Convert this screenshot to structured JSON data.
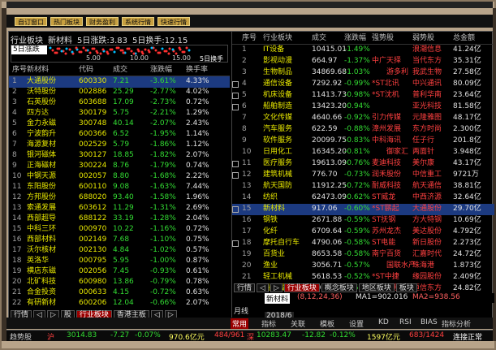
{
  "toolbar": {
    "buttons": [
      "自订窗口",
      "热门板块",
      "财务盈利",
      "系统行情",
      "快速行情"
    ]
  },
  "left": {
    "title_parts": [
      "行业板块",
      "新材料",
      "5日涨跌:3.83",
      "5日换手:12.15"
    ],
    "window_label": "5日涨跌",
    "scale": [
      "5.00",
      "10.00",
      "15.00",
      "5日换手"
    ],
    "headers": [
      "序号",
      "新材料",
      "代码",
      "成交",
      "涨跌幅",
      "换手率"
    ],
    "rows": [
      [
        "1",
        "大通股份",
        "600330",
        "7.21",
        "-3.61%",
        "4.33%"
      ],
      [
        "2",
        "沃特股份",
        "002886",
        "25.29",
        "-2.77%",
        "4.02%"
      ],
      [
        "3",
        "石英股份",
        "603688",
        "17.09",
        "-2.73%",
        "0.72%"
      ],
      [
        "4",
        "四方达",
        "300179",
        "5.75",
        "-2.21%",
        "1.29%"
      ],
      [
        "5",
        "金力永磁",
        "300748",
        "40.14",
        "-2.07%",
        "2.43%"
      ],
      [
        "6",
        "宁波韵升",
        "600366",
        "6.52",
        "-1.95%",
        "1.14%"
      ],
      [
        "7",
        "海源复材",
        "002529",
        "5.79",
        "-1.86%",
        "1.12%"
      ],
      [
        "8",
        "银河磁体",
        "300127",
        "18.85",
        "-1.82%",
        "2.07%"
      ],
      [
        "9",
        "正海磁材",
        "300224",
        "8.76",
        "-1.79%",
        "0.74%"
      ],
      [
        "10",
        "中钢天源",
        "002057",
        "8.80",
        "-1.68%",
        "2.22%"
      ],
      [
        "11",
        "东阳股份",
        "600110",
        "9.08",
        "-1.63%",
        "7.44%"
      ],
      [
        "12",
        "方邦股份",
        "688020",
        "93.40",
        "-1.58%",
        "1.96%"
      ],
      [
        "13",
        "索通发展",
        "603612",
        "11.29",
        "-1.31%",
        "2.69%"
      ],
      [
        "14",
        "西部超导",
        "688122",
        "33.19",
        "-1.28%",
        "2.04%"
      ],
      [
        "15",
        "中科三环",
        "000970",
        "10.22",
        "-1.16%",
        "0.72%"
      ],
      [
        "16",
        "西部材料",
        "002149",
        "7.68",
        "-1.10%",
        "0.75%"
      ],
      [
        "17",
        "沃尔核材",
        "002130",
        "4.84",
        "-1.02%",
        "0.57%"
      ],
      [
        "18",
        "英洛华",
        "000795",
        "5.95",
        "-1.00%",
        "0.87%"
      ],
      [
        "19",
        "横店东磁",
        "002056",
        "7.45",
        "-0.93%",
        "0.61%"
      ],
      [
        "20",
        "北矿科技",
        "600980",
        "13.86",
        "-0.79%",
        "0.78%"
      ],
      [
        "21",
        "合金投资",
        "000633",
        "4.15",
        "-0.72%",
        "0.63%"
      ],
      [
        "22",
        "有研新材",
        "600206",
        "12.04",
        "-0.66%",
        "2.07%"
      ]
    ],
    "tabs": [
      "行情",
      "◁",
      "▷",
      "股",
      "行业板块",
      "香港主板",
      "◁",
      "▷"
    ]
  },
  "right": {
    "headers": [
      "序号",
      "行业板块",
      "成交",
      "涨跌幅",
      "强势股",
      "弱势股",
      "总金额"
    ],
    "rows": [
      [
        "1",
        "IT设备",
        "10415.01",
        "-1.49%",
        "",
        "浪潮信息",
        "41.24亿"
      ],
      [
        "2",
        "影视动漫",
        "664.97",
        "-1.37%",
        "中广天择",
        "当代东方",
        "35.31亿"
      ],
      [
        "3",
        "生物制品",
        "34869.68",
        "-1.03%",
        "",
        "游多利",
        "我武生物",
        "27.58亿"
      ],
      [
        "4",
        "通信设备",
        "7292.92",
        "-0.99%",
        "*ST北讯",
        "中兴通讯",
        "80.09亿"
      ],
      [
        "5",
        "机床设备",
        "11413.73",
        "-0.98%",
        "*ST沈机",
        "普利华南",
        "23.64亿"
      ],
      [
        "6",
        "船舶制造",
        "13423.20",
        "-0.94%",
        "",
        "亚光科技",
        "81.58亿"
      ],
      [
        "7",
        "文化传媒",
        "4640.66",
        "-0.92%",
        "引力传媒",
        "元隆雅图",
        "48.17亿"
      ],
      [
        "8",
        "汽车服务",
        "622.59",
        "-0.88%",
        "漳州发展",
        "东方时尚",
        "2.300亿"
      ],
      [
        "9",
        "软件服务",
        "20099.75",
        "-0.83%",
        "中科海讯",
        "任子行",
        "201.8亿"
      ],
      [
        "10",
        "日用化工",
        "16345.20",
        "-0.81%",
        "",
        "御家汇",
        "两面针",
        "3.948亿"
      ],
      [
        "11",
        "医疗服务",
        "19613.09",
        "-0.76%",
        "麦迪科技",
        "美尔康",
        "43.17亿"
      ],
      [
        "12",
        "建筑机械",
        "776.70",
        "-0.73%",
        "润禾股份",
        "中信重工",
        "9721万"
      ],
      [
        "13",
        "航天国防",
        "11912.25",
        "-0.72%",
        "耐威科技",
        "航天通信",
        "38.81亿"
      ],
      [
        "14",
        "纺织",
        "62473.09",
        "-0.62%",
        "ST威龙",
        "中西济源",
        "32.64亿"
      ],
      [
        "15",
        "新材料",
        "917.06",
        "-0.60%",
        "*ST鹏起",
        "大通股份",
        "29.70亿"
      ],
      [
        "16",
        "钢铁",
        "2671.88",
        "-0.59%",
        "ST抚钢",
        "方大特钢",
        "10.69亿"
      ],
      [
        "17",
        "化纤",
        "6709.64",
        "-0.59%",
        "苏州龙杰",
        "美达股份",
        "4.792亿"
      ],
      [
        "18",
        "摩托自行车",
        "4790.06",
        "-0.58%",
        "ST电能",
        "新日股份",
        "2.273亿"
      ],
      [
        "19",
        "百货业",
        "8653.58",
        "-0.58%",
        "南宁百货",
        "汇嘉时代",
        "24.72亿"
      ],
      [
        "20",
        "渔业",
        "3056.71",
        "-0.57%",
        "",
        "国联水产",
        "珠海港",
        "1.873亿"
      ],
      [
        "21",
        "轻工机械",
        "5618.53",
        "-0.52%",
        "*ST中捷",
        "缘园股份",
        "2.409亿"
      ],
      [
        "22",
        "通信服务",
        "5904.50",
        "-0.50%",
        "号百控股",
        "恒信东方",
        "24.82亿"
      ]
    ],
    "tabs": [
      "行情",
      "◁",
      "▷",
      "行业板块",
      "概念板块",
      "地区板块",
      "板块"
    ],
    "indicator": {
      "name": "新材料",
      "param": "(8,12,24,36)",
      "ma1": "MA1=902.016",
      "ma2": "MA2=938.56"
    },
    "period": "月线",
    "date": "2018/6",
    "bottom_tabs": [
      "常用",
      "指标",
      "关联",
      "模板",
      "设置",
      "KD",
      "RSI",
      "BIAS",
      "指标分析"
    ]
  },
  "status": {
    "sh_label": "沪",
    "sh_index": "3014.83",
    "sh_change": "-7.27",
    "sh_pct": "-0.07%",
    "sh_amount": "970.6亿元",
    "sh_updown": "484/961",
    "sz_label": "深",
    "sz_index": "10283.47",
    "sz_change": "-12.82",
    "sz_pct": "-0.12%",
    "sz_amount": "1597亿元",
    "sz_updown": "683/1424",
    "conn": "连接正常",
    "left_label": "趋势股"
  }
}
